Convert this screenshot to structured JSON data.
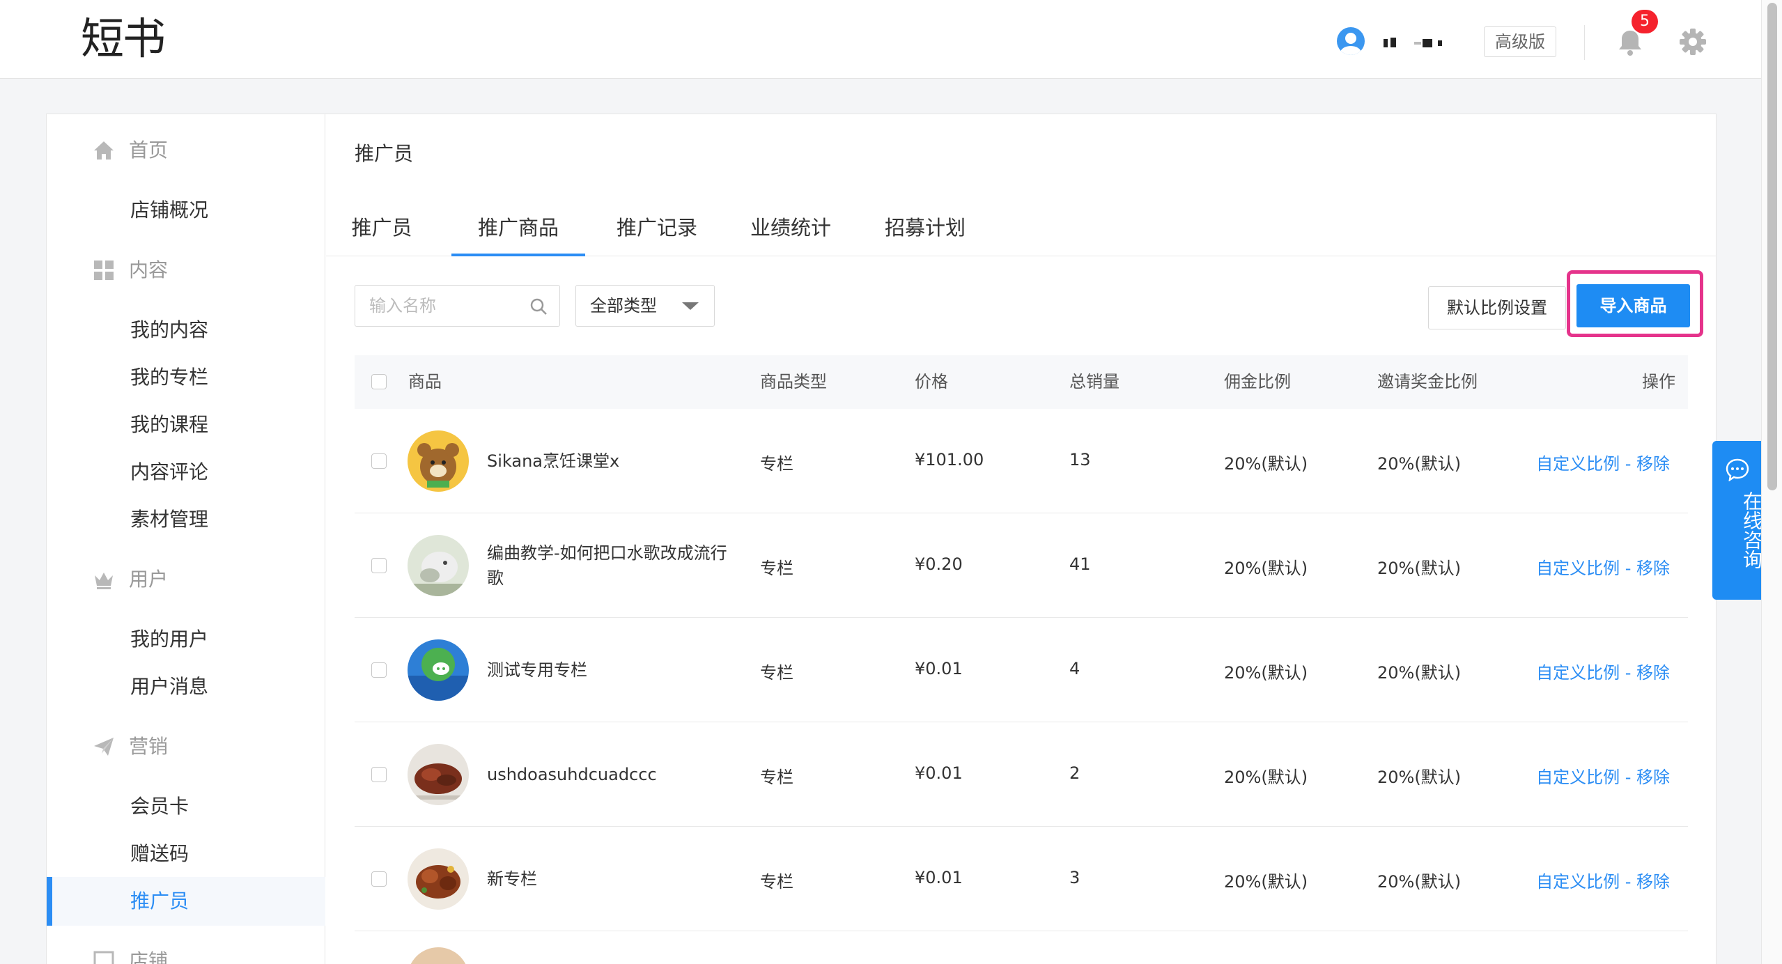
{
  "topbar": {
    "logo": "短书",
    "plan_label": "高级版",
    "notification_count": "5"
  },
  "sidebar": {
    "groups": [
      {
        "label": "首页",
        "icon": "home-icon",
        "items": [
          "店铺概况"
        ]
      },
      {
        "label": "内容",
        "icon": "grid-icon",
        "items": [
          "我的内容",
          "我的专栏",
          "我的课程",
          "内容评论",
          "素材管理"
        ]
      },
      {
        "label": "用户",
        "icon": "crown-icon",
        "items": [
          "我的用户",
          "用户消息"
        ]
      },
      {
        "label": "营销",
        "icon": "paper-plane-icon",
        "items": [
          "会员卡",
          "赠送码",
          "推广员"
        ]
      },
      {
        "label": "店铺",
        "icon": "shop-icon",
        "items": []
      }
    ],
    "active_item": "推广员"
  },
  "main": {
    "title": "推广员",
    "tabs": [
      {
        "label": "推广员",
        "active": false
      },
      {
        "label": "推广商品",
        "active": true
      },
      {
        "label": "推广记录",
        "active": false
      },
      {
        "label": "业绩统计",
        "active": false
      },
      {
        "label": "招募计划",
        "active": false
      }
    ],
    "search": {
      "placeholder": "输入名称",
      "value": ""
    },
    "type_filter": {
      "selected": "全部类型"
    },
    "default_ratio_button": "默认比例设置",
    "import_button": "导入商品",
    "table": {
      "columns": [
        "商品",
        "商品类型",
        "价格",
        "总销量",
        "佣金比例",
        "邀请奖金比例",
        "操作"
      ],
      "rows": [
        {
          "name": "Sikana烹饪课堂x",
          "type": "专栏",
          "price": "¥101.00",
          "sales": "13",
          "commission": "20%(默认)",
          "invite_bonus": "20%(默认)",
          "op_custom": "自定义比例",
          "op_sep": " - ",
          "op_remove": "移除"
        },
        {
          "name": "编曲教学-如何把口水歌改成流行歌",
          "type": "专栏",
          "price": "¥0.20",
          "sales": "41",
          "commission": "20%(默认)",
          "invite_bonus": "20%(默认)",
          "op_custom": "自定义比例",
          "op_sep": " - ",
          "op_remove": "移除"
        },
        {
          "name": "测试专用专栏",
          "type": "专栏",
          "price": "¥0.01",
          "sales": "4",
          "commission": "20%(默认)",
          "invite_bonus": "20%(默认)",
          "op_custom": "自定义比例",
          "op_sep": " - ",
          "op_remove": "移除"
        },
        {
          "name": "ushdoasuhdcuadccc",
          "type": "专栏",
          "price": "¥0.01",
          "sales": "2",
          "commission": "20%(默认)",
          "invite_bonus": "20%(默认)",
          "op_custom": "自定义比例",
          "op_sep": " - ",
          "op_remove": "移除"
        },
        {
          "name": "新专栏",
          "type": "专栏",
          "price": "¥0.01",
          "sales": "3",
          "commission": "20%(默认)",
          "invite_bonus": "20%(默认)",
          "op_custom": "自定义比例",
          "op_sep": " - ",
          "op_remove": "移除"
        }
      ]
    }
  },
  "consult": {
    "label": "在线咨询"
  },
  "colors": {
    "accent": "#1e8cf3",
    "highlight": "#e5338b",
    "badge": "#f5222d"
  }
}
